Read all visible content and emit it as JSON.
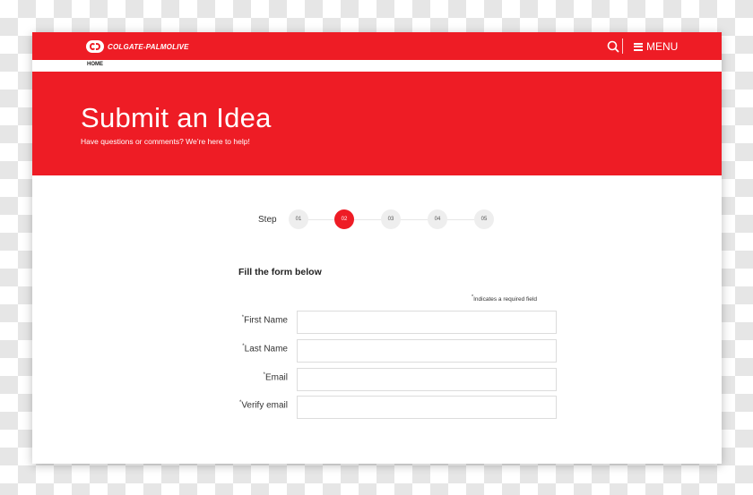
{
  "brand": {
    "logo_text": "COLGATE-PALMOLIVE",
    "primary_color": "#ee1c25"
  },
  "header": {
    "search_icon": "search-icon",
    "menu_label": "MENU",
    "menu_icon": "hamburger-icon"
  },
  "breadcrumb": {
    "home": "HOME"
  },
  "hero": {
    "title": "Submit an Idea",
    "subtitle": "Have questions or comments? We’re here to help!"
  },
  "steps": {
    "label": "Step",
    "items": [
      "01",
      "02",
      "03",
      "04",
      "05"
    ],
    "active_index": 1
  },
  "form": {
    "heading": "Fill the form below",
    "required_marker": "*",
    "required_note": "Indicates a required field",
    "fields": [
      {
        "label": "First Name",
        "value": "",
        "placeholder": ""
      },
      {
        "label": "Last Name",
        "value": "",
        "placeholder": ""
      },
      {
        "label": "Email",
        "value": "",
        "placeholder": ""
      },
      {
        "label": "Verify email",
        "value": "",
        "placeholder": ""
      }
    ]
  }
}
